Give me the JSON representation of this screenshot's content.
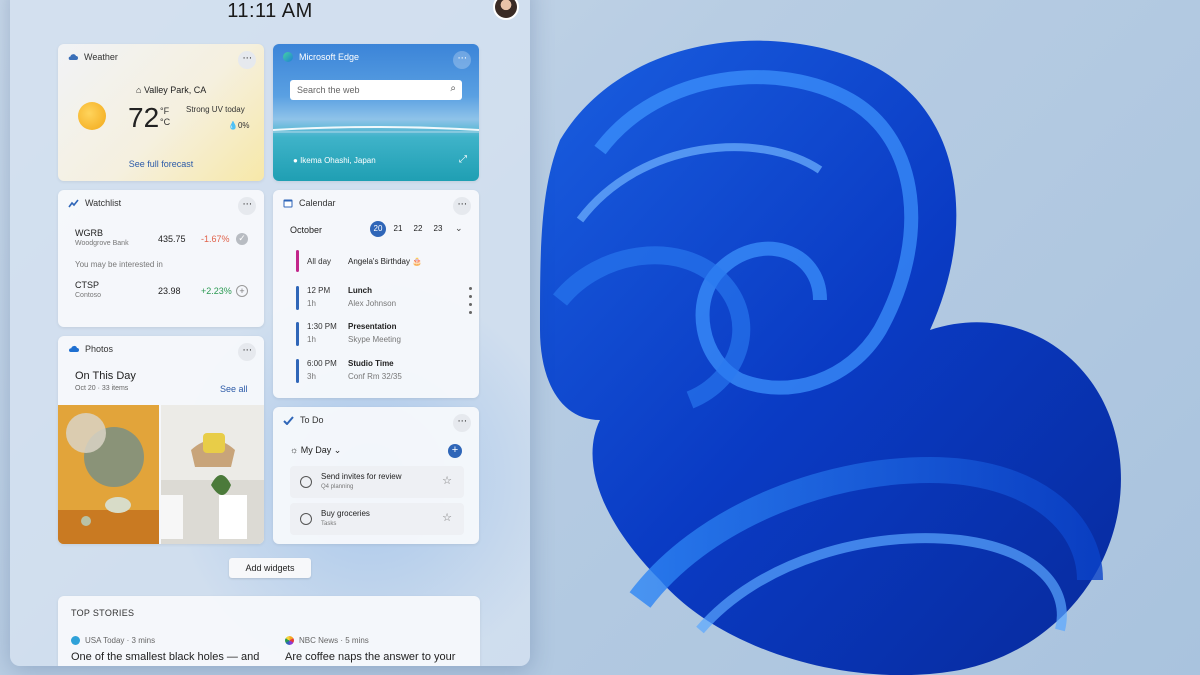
{
  "clock": "11:11 AM",
  "weather": {
    "title": "Weather",
    "location": "Valley Park, CA",
    "temp": "72",
    "unit_f": "°F",
    "unit_c": "°C",
    "condition": "Strong UV today",
    "precip": "0%",
    "link": "See full forecast",
    "more": "···"
  },
  "edge": {
    "title": "Microsoft Edge",
    "search_placeholder": "Search the web",
    "location": "Ikema Ohashi, Japan",
    "more": "···"
  },
  "watchlist": {
    "title": "Watchlist",
    "more": "···",
    "stocks": [
      {
        "symbol": "WGRB",
        "name": "Woodgrove Bank",
        "price": "435.75",
        "change": "-1.67%"
      },
      {
        "symbol": "CTSP",
        "name": "Contoso",
        "price": "23.98",
        "change": "+2.23%"
      }
    ],
    "suggest_label": "You may be interested in"
  },
  "calendar": {
    "title": "Calendar",
    "more": "···",
    "month": "October",
    "days": [
      "20",
      "21",
      "22",
      "23"
    ],
    "events": [
      {
        "time": "All day",
        "duration": "",
        "title": "Angela's Birthday 🎂",
        "sub": ""
      },
      {
        "time": "12 PM",
        "duration": "1h",
        "title": "Lunch",
        "sub": "Alex Johnson"
      },
      {
        "time": "1:30 PM",
        "duration": "1h",
        "title": "Presentation",
        "sub": "Skype Meeting"
      },
      {
        "time": "6:00 PM",
        "duration": "3h",
        "title": "Studio Time",
        "sub": "Conf Rm 32/35"
      }
    ]
  },
  "photos": {
    "title": "Photos",
    "more": "···",
    "heading": "On This Day",
    "sub": "Oct 20 · 33 items",
    "link": "See all"
  },
  "todo": {
    "title": "To Do",
    "more": "···",
    "list": "My Day",
    "tasks": [
      {
        "title": "Send invites for review",
        "sub": "Q4 planning"
      },
      {
        "title": "Buy groceries",
        "sub": "Tasks"
      }
    ]
  },
  "add_widgets": "Add widgets",
  "stories": {
    "header": "TOP STORIES",
    "items": [
      {
        "source": "USA Today · 3 mins",
        "headline": "One of the smallest black holes — and"
      },
      {
        "source": "NBC News · 5 mins",
        "headline": "Are coffee naps the answer to your"
      }
    ]
  },
  "colors": {
    "accent": "#2f66b8",
    "negative": "#e0624a",
    "positive": "#2b9a52"
  }
}
